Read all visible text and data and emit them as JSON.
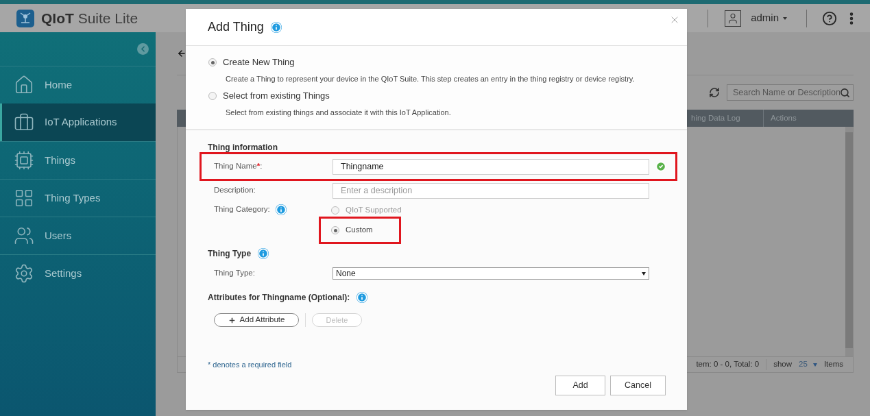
{
  "app": {
    "brand": "QIoT",
    "brand_rest": "Suite Lite"
  },
  "header": {
    "user": "admin"
  },
  "sidebar": {
    "items": [
      {
        "label": "Home",
        "selected": false
      },
      {
        "label": "IoT Applications",
        "selected": true
      },
      {
        "label": "Things",
        "selected": false
      },
      {
        "label": "Thing Types",
        "selected": false
      },
      {
        "label": "Users",
        "selected": false
      },
      {
        "label": "Settings",
        "selected": false
      }
    ]
  },
  "background": {
    "search_placeholder": "Search Name or Description",
    "columns": [
      "hing Data Log",
      "Actions"
    ],
    "pager": {
      "summary": "tem: 0 - 0, Total: 0",
      "show": "show",
      "page_size": "25",
      "items": "Items"
    }
  },
  "dialog": {
    "title": "Add Thing",
    "modes": [
      {
        "label": "Create New Thing",
        "description": "Create a Thing to represent your device in the QIoT Suite. This step creates an entry in the thing registry or device registry.",
        "selected": true
      },
      {
        "label": "Select from existing Things",
        "description": "Select from existing things and associate it with this IoT Application.",
        "selected": false
      }
    ],
    "info_heading": "Thing information",
    "name": {
      "label": "Thing Name",
      "required_mark": "*",
      "suffix": ":",
      "value": "Thingname",
      "valid": true,
      "highlighted": true
    },
    "description": {
      "label": "Description:",
      "placeholder": "Enter a description"
    },
    "category": {
      "label": "Thing Category:",
      "options": [
        {
          "label": "QIoT Supported",
          "selected": false,
          "highlighted": false
        },
        {
          "label": "Custom",
          "selected": true,
          "highlighted": true
        }
      ]
    },
    "thing_type": {
      "heading": "Thing Type",
      "label": "Thing Type:",
      "value": "None"
    },
    "attributes": {
      "heading": "Attributes for Thingname (Optional):",
      "add_button": "Add Attribute",
      "delete_button": {
        "label": "Delete",
        "disabled": true
      }
    },
    "footnote": "* denotes a required field",
    "buttons": [
      "Add",
      "Cancel"
    ]
  }
}
